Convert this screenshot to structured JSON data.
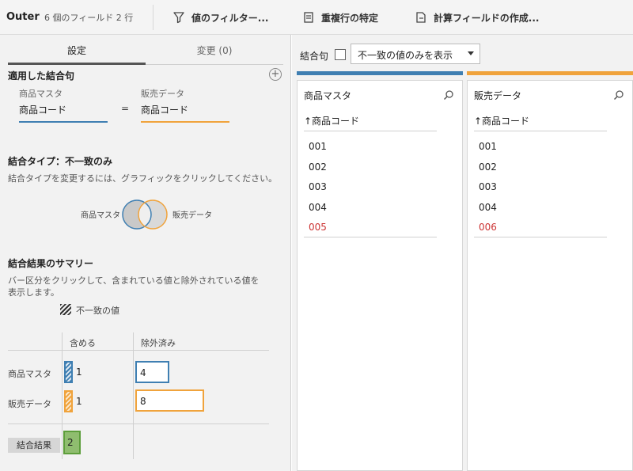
{
  "toolbar": {
    "title": "Outer",
    "meta": "6 個のフィールド  2 行",
    "filter_label": "値のフィルター...",
    "duplicate_label": "重複行の特定",
    "calc_label": "計算フィールドの作成..."
  },
  "left": {
    "tabs": [
      "設定",
      "変更 (0)"
    ],
    "applied_clauses_title": "適用した結合句",
    "clause": {
      "left_table": "商品マスタ",
      "left_field": "商品コード",
      "operator": "=",
      "right_table": "販売データ",
      "right_field": "商品コード"
    },
    "join_type_title": "結合タイプ：不一致のみ",
    "join_type_desc": "結合タイプを変更するには、グラフィックをクリックしてください。",
    "venn_left_label": "商品マスタ",
    "venn_right_label": "販売データ",
    "summary_title": "結合結果のサマリー",
    "summary_desc_line1": "バー区分をクリックして、含まれている値と除外されている値を",
    "summary_desc_line2": "表示します。",
    "legend_label": "不一致の値",
    "columns": [
      "含める",
      "除外済み"
    ],
    "rows": [
      {
        "label": "商品マスタ",
        "included": "1",
        "excluded": "4"
      },
      {
        "label": "販売データ",
        "included": "1",
        "excluded": "8"
      }
    ],
    "result_label": "結合結果",
    "result_value": "2"
  },
  "right": {
    "clause_label": "結合句",
    "select_value": "不一致の値のみを表示",
    "tables": [
      {
        "name": "商品マスタ",
        "column": "↑商品コード",
        "values": [
          "001",
          "002",
          "003",
          "004",
          "005"
        ],
        "unmatched": "005"
      },
      {
        "name": "販売データ",
        "column": "↑商品コード",
        "values": [
          "001",
          "002",
          "003",
          "004",
          "006"
        ],
        "unmatched": "006"
      }
    ]
  },
  "colors": {
    "left_table": "#3f7fb2",
    "right_table": "#f0a33c",
    "result": "#8fbd6f",
    "unmatched_value": "#cc3333"
  }
}
